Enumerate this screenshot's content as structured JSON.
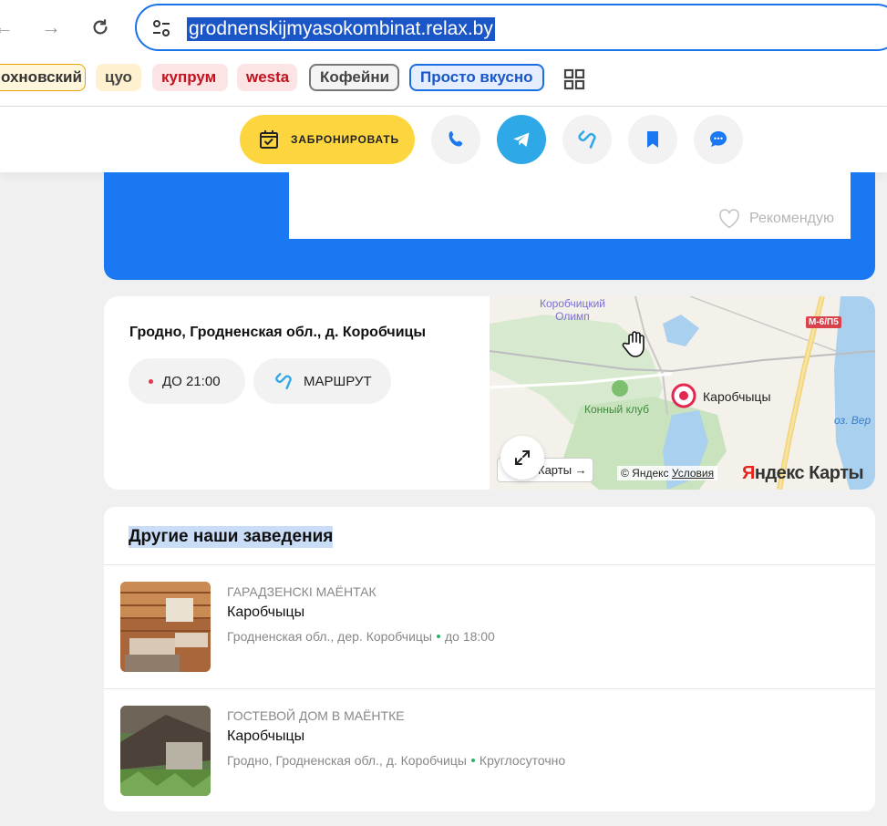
{
  "browser": {
    "url": "grodnenskijmyasokombinat.relax.by",
    "bookmarks": [
      "охновский",
      "цуо",
      "купрум",
      "westa",
      "Кофейни",
      "Просто вкусно"
    ]
  },
  "actions": {
    "book_label": "ЗАБРОНИРОВАТЬ",
    "buttons": [
      "phone-icon",
      "telegram-icon",
      "route-icon",
      "bookmark-icon",
      "chat-icon"
    ]
  },
  "review": {
    "recommend_label": "Рекомендую"
  },
  "location": {
    "address": "Гродно, Гродненская обл., д. Коробчицы",
    "hours_label": "ДО 21:00",
    "route_label": "МАРШРУТ",
    "map": {
      "poi_olimp_1": "Коробчицкий",
      "poi_olimp_2": "Олимп",
      "poi_club": "Конный клуб",
      "lake": "оз. Вер",
      "road_sign": "М-6/П5",
      "place": "Каробчыцы",
      "maps_link": "Карты →",
      "copyright_prefix": "© Яндекс",
      "copyright_link": "Условия",
      "logo_y": "Я",
      "logo_rest": "ндекс Карты"
    }
  },
  "other_places": {
    "title": "Другие наши заведения",
    "items": [
      {
        "category": "ГАРАДЗЕНСКІ МАЁНТАК",
        "name": "Каробчыцы",
        "address": "Гродненская обл., дер. Коробчицы",
        "hours": "до 18:00"
      },
      {
        "category": "ГОСТЕВОЙ ДОМ В МАЁНТКЕ",
        "name": "Каробчыцы",
        "address": "Гродно, Гродненская обл., д. Коробчицы",
        "hours": "Круглосуточно"
      }
    ]
  },
  "colors": {
    "accent_blue": "#1a78f2",
    "book_yellow": "#fdd63f",
    "telegram_blue": "#2ea8e6",
    "status_green": "#2bb36b",
    "status_red": "#e8344b"
  }
}
